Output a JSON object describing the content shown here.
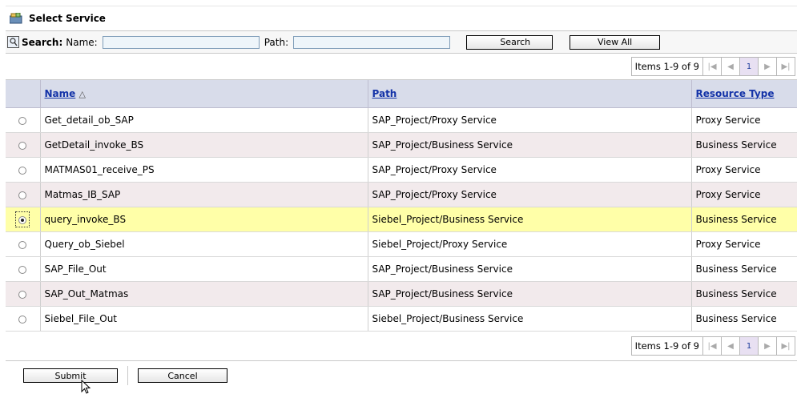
{
  "title": "Select Service",
  "search": {
    "label": "Search:",
    "name_label": "Name:",
    "name_value": "",
    "path_label": "Path:",
    "path_value": "",
    "search_button": "Search",
    "view_all_button": "View All"
  },
  "pager": {
    "info": "Items 1-9 of 9",
    "current_page": "1",
    "first_icon": "first-page-icon",
    "prev_icon": "prev-page-icon",
    "next_icon": "next-page-icon",
    "last_icon": "last-page-icon"
  },
  "table": {
    "columns": {
      "name": "Name",
      "path": "Path",
      "type": "Resource Type"
    },
    "sort_indicator": "△",
    "rows": [
      {
        "name": "Get_detail_ob_SAP",
        "path": "SAP_Project/Proxy Service",
        "type": "Proxy Service",
        "selected": false
      },
      {
        "name": "GetDetail_invoke_BS",
        "path": "SAP_Project/Business Service",
        "type": "Business Service",
        "selected": false
      },
      {
        "name": "MATMAS01_receive_PS",
        "path": "SAP_Project/Proxy Service",
        "type": "Proxy Service",
        "selected": false
      },
      {
        "name": "Matmas_IB_SAP",
        "path": "SAP_Project/Proxy Service",
        "type": "Proxy Service",
        "selected": false
      },
      {
        "name": "query_invoke_BS",
        "path": "Siebel_Project/Business Service",
        "type": "Business Service",
        "selected": true
      },
      {
        "name": "Query_ob_Siebel",
        "path": "Siebel_Project/Proxy Service",
        "type": "Proxy Service",
        "selected": false
      },
      {
        "name": "SAP_File_Out",
        "path": "SAP_Project/Business Service",
        "type": "Business Service",
        "selected": false
      },
      {
        "name": "SAP_Out_Matmas",
        "path": "SAP_Project/Business Service",
        "type": "Business Service",
        "selected": false
      },
      {
        "name": "Siebel_File_Out",
        "path": "Siebel_Project/Business Service",
        "type": "Business Service",
        "selected": false
      }
    ]
  },
  "actions": {
    "submit": "Submit",
    "cancel": "Cancel"
  },
  "colors": {
    "header_bg": "#d8dcea",
    "row_alt_bg": "#f2eaec",
    "selected_bg": "#ffffa8",
    "link": "#1433a8"
  }
}
